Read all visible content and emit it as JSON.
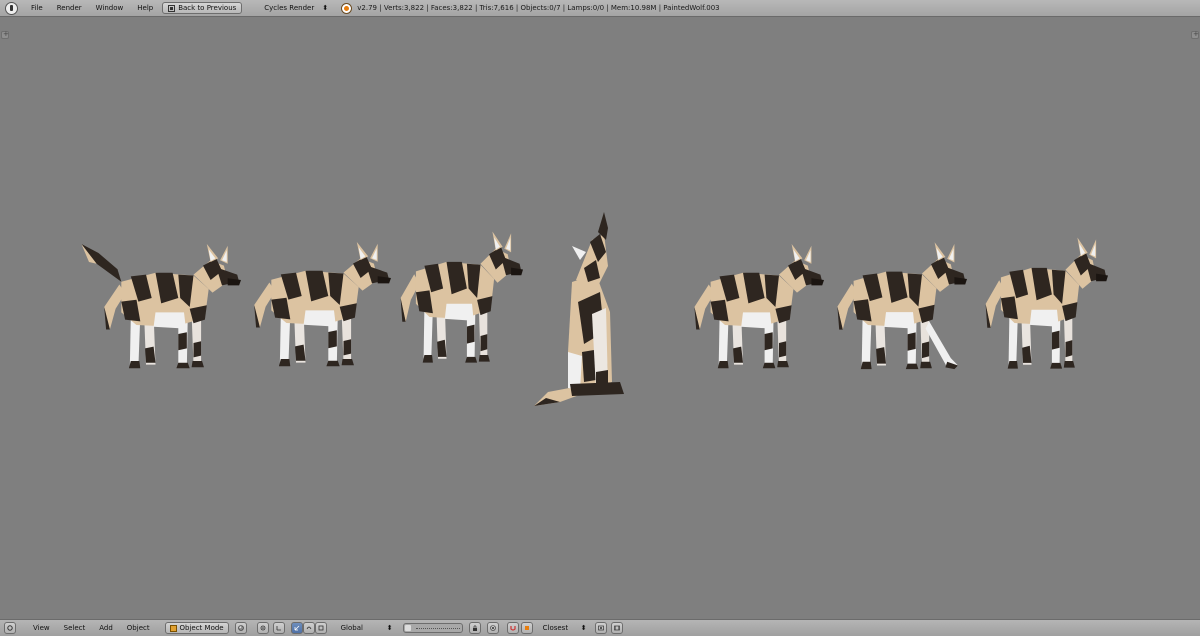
{
  "top_menu": {
    "items": [
      "File",
      "Render",
      "Window",
      "Help"
    ],
    "back_button": "Back to Previous",
    "engine": "Cycles Render",
    "stats": "v2.79 | Verts:3,822 | Faces:3,822 | Tris:7,616 | Objects:0/7 | Lamps:0/0 | Mem:10.98M | PaintedWolf.003"
  },
  "bottom_menu": {
    "items": [
      "View",
      "Select",
      "Add",
      "Object"
    ],
    "mode": "Object Mode",
    "orientation": "Global",
    "snap_target": "Closest"
  },
  "icons": {
    "editor_type": "info-icon",
    "back": "back-to-previous-icon",
    "blender_logo": "blender-logo-icon",
    "view3d": "view3d-editor-icon",
    "shading": "viewport-shading-icon",
    "pivot": "pivot-point-icon",
    "manipulator": "manipulator-icon",
    "translate": "translate-icon",
    "rotate": "rotate-icon",
    "scale": "scale-icon",
    "layers": "layers-icon",
    "lock": "lock-layers-icon",
    "proportional": "proportional-edit-icon",
    "snap": "snap-magnet-icon",
    "opengl_render": "opengl-render-icon",
    "opengl_anim": "opengl-animation-icon"
  },
  "colors": {
    "viewport_bg": "#7f7f7f",
    "fur_dark": "#2e2620",
    "fur_tan": "#dcc3a1",
    "fur_white": "#f0f0f0"
  },
  "scene": {
    "wolves": [
      {
        "pose": "tail-raised"
      },
      {
        "pose": "walking-head-low"
      },
      {
        "pose": "standing-alert"
      },
      {
        "pose": "sitting-howling"
      },
      {
        "pose": "walking"
      },
      {
        "pose": "pawing"
      },
      {
        "pose": "standing"
      }
    ]
  }
}
